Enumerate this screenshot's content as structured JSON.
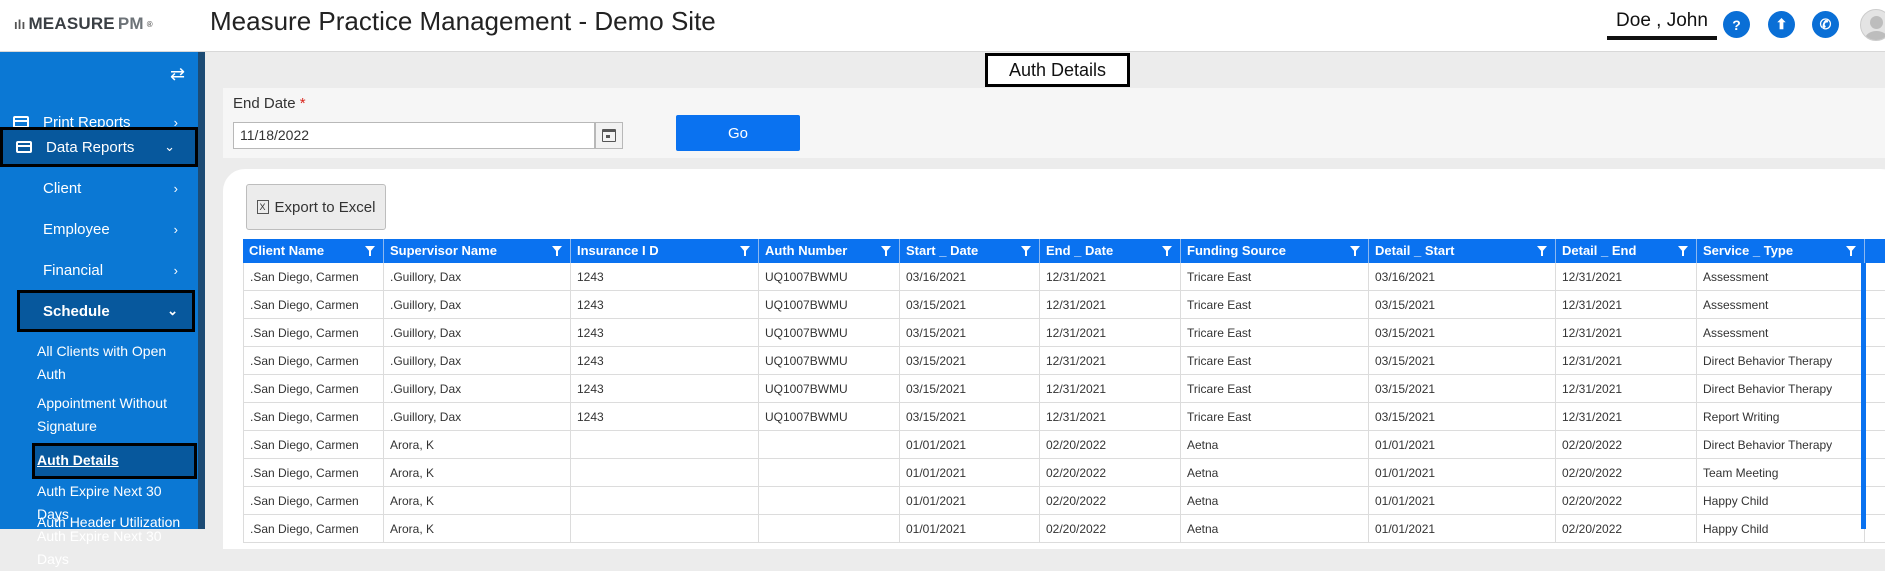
{
  "header": {
    "logo_prefix": "MEASURE",
    "logo_suffix": "PM",
    "logo_mark": "ılı",
    "logo_tm": "®",
    "title": "Measure Practice Management - Demo Site",
    "user_name": "Doe , John",
    "icons": [
      "help-icon",
      "upload-icon",
      "phone-icon",
      "avatar"
    ],
    "help_glyph": "?",
    "upload_glyph": "⬆",
    "phone_glyph": "✆"
  },
  "sidebar": {
    "toggle_glyph": "⇄",
    "items": [
      {
        "label": "Print Reports",
        "chev": "›"
      },
      {
        "label": "Data Reports",
        "chev": "⌄"
      },
      {
        "label": "Client",
        "chev": "›"
      },
      {
        "label": "Employee",
        "chev": "›"
      },
      {
        "label": "Financial",
        "chev": "›"
      },
      {
        "label": "Schedule",
        "chev": "⌄"
      }
    ],
    "leaves": [
      {
        "label": "All Clients with Open Auth"
      },
      {
        "label": "Appointment Without Signature"
      },
      {
        "label": "Auth Details"
      },
      {
        "label": "Auth Expire Next 30 Days"
      },
      {
        "label": "Auth Header Utilization"
      }
    ]
  },
  "page": {
    "heading": "Auth Details",
    "end_date_label": "End Date",
    "required_mark": "*",
    "end_date_value": "11/18/2022",
    "go_label": "Go",
    "export_label": "Export to Excel",
    "export_icon_glyph": "X"
  },
  "grid": {
    "columns": [
      "Client Name",
      "Supervisor Name",
      "Insurance I D",
      "Auth Number",
      "Start _ Date",
      "End _ Date",
      "Funding Source",
      "Detail _ Start",
      "Detail _ End",
      "Service _ Type"
    ],
    "rows": [
      [
        ".San Diego, Carmen",
        ".Guillory, Dax",
        "1243",
        "UQ1007BWMU",
        "03/16/2021",
        "12/31/2021",
        "Tricare East",
        "03/16/2021",
        "12/31/2021",
        "Assessment"
      ],
      [
        ".San Diego, Carmen",
        ".Guillory, Dax",
        "1243",
        "UQ1007BWMU",
        "03/15/2021",
        "12/31/2021",
        "Tricare East",
        "03/15/2021",
        "12/31/2021",
        "Assessment"
      ],
      [
        ".San Diego, Carmen",
        ".Guillory, Dax",
        "1243",
        "UQ1007BWMU",
        "03/15/2021",
        "12/31/2021",
        "Tricare East",
        "03/15/2021",
        "12/31/2021",
        "Assessment"
      ],
      [
        ".San Diego, Carmen",
        ".Guillory, Dax",
        "1243",
        "UQ1007BWMU",
        "03/15/2021",
        "12/31/2021",
        "Tricare East",
        "03/15/2021",
        "12/31/2021",
        "Direct Behavior Therapy"
      ],
      [
        ".San Diego, Carmen",
        ".Guillory, Dax",
        "1243",
        "UQ1007BWMU",
        "03/15/2021",
        "12/31/2021",
        "Tricare East",
        "03/15/2021",
        "12/31/2021",
        "Direct Behavior Therapy"
      ],
      [
        ".San Diego, Carmen",
        ".Guillory, Dax",
        "1243",
        "UQ1007BWMU",
        "03/15/2021",
        "12/31/2021",
        "Tricare East",
        "03/15/2021",
        "12/31/2021",
        "Report Writing"
      ],
      [
        ".San Diego, Carmen",
        "Arora, K",
        "",
        "",
        "01/01/2021",
        "02/20/2022",
        "Aetna",
        "01/01/2021",
        "02/20/2022",
        "Direct Behavior Therapy"
      ],
      [
        ".San Diego, Carmen",
        "Arora, K",
        "",
        "",
        "01/01/2021",
        "02/20/2022",
        "Aetna",
        "01/01/2021",
        "02/20/2022",
        "Team Meeting"
      ],
      [
        ".San Diego, Carmen",
        "Arora, K",
        "",
        "",
        "01/01/2021",
        "02/20/2022",
        "Aetna",
        "01/01/2021",
        "02/20/2022",
        "Happy Child"
      ],
      [
        ".San Diego, Carmen",
        "Arora, K",
        "",
        "",
        "01/01/2021",
        "02/20/2022",
        "Aetna",
        "01/01/2021",
        "02/20/2022",
        "Happy Child"
      ]
    ]
  }
}
